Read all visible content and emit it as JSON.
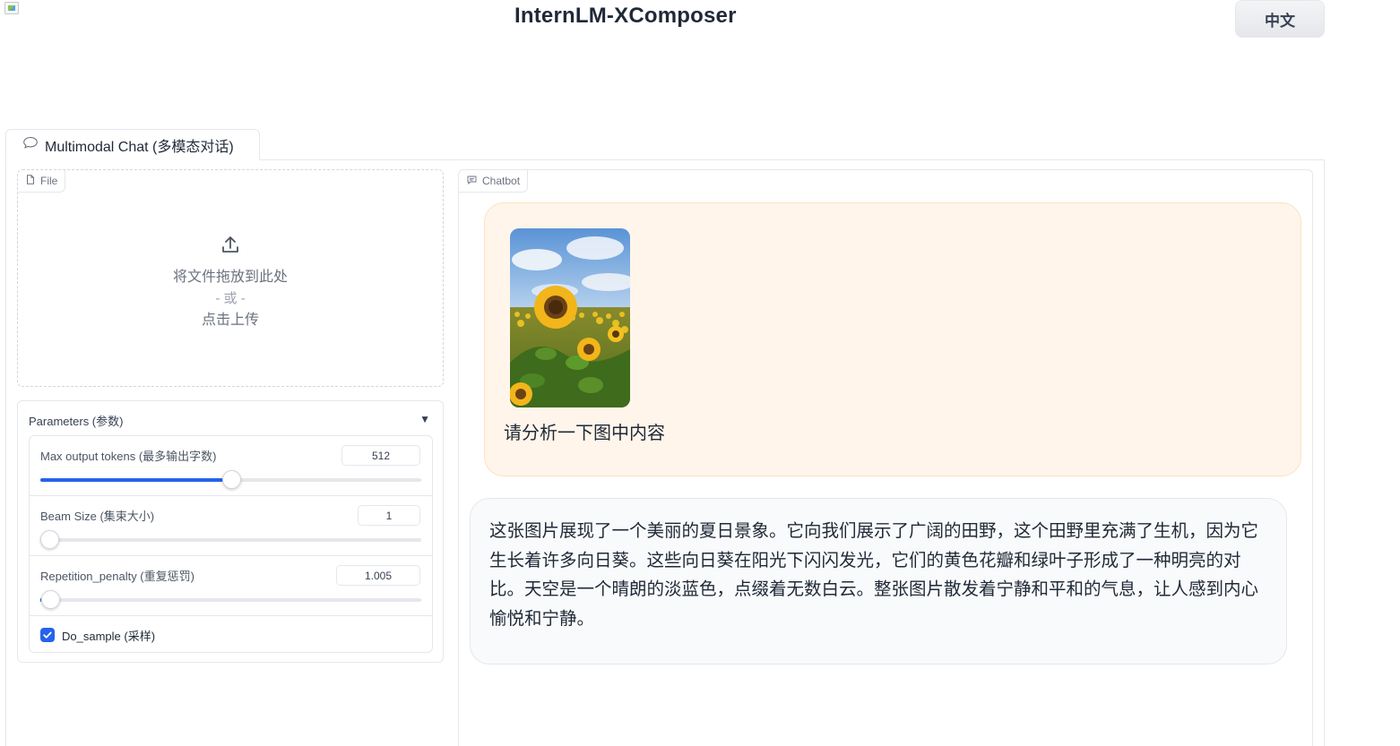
{
  "header": {
    "title": "InternLM-XComposer",
    "language_button": "中文"
  },
  "tabs": [
    {
      "label": "Multimodal Chat (多模态对话)",
      "icon": "speech-bubble-icon"
    }
  ],
  "file_upload": {
    "label": "File",
    "drop_text": "将文件拖放到此处",
    "or_text": "- 或 -",
    "click_text": "点击上传"
  },
  "parameters": {
    "title": "Parameters (参数)",
    "sliders": [
      {
        "label": "Max output tokens (最多输出字数)",
        "value": "512",
        "fraction": 0.5
      },
      {
        "label": "Beam Size (集束大小)",
        "value": "1",
        "fraction": 0.0
      },
      {
        "label": "Repetition_penalty (重复惩罚)",
        "value": "1.005",
        "fraction": 0.003
      }
    ],
    "do_sample": {
      "label": "Do_sample (采样)",
      "checked": true
    }
  },
  "chatbot": {
    "label": "Chatbot",
    "messages": [
      {
        "role": "user",
        "image": "sunflower-field-photo",
        "text": "请分析一下图中内容"
      },
      {
        "role": "bot",
        "text": "这张图片展现了一个美丽的夏日景象。它向我们展示了广阔的田野，这个田野里充满了生机，因为它生长着许多向日葵。这些向日葵在阳光下闪闪发光，它们的黄色花瓣和绿叶子形成了一种明亮的对比。天空是一个晴朗的淡蓝色，点缀着无数白云。整张图片散发着宁静和平和的气息，让人感到内心愉悦和宁静。"
      }
    ]
  },
  "colors": {
    "accent": "#2563eb",
    "user_bubble": "#fff5ea",
    "user_bubble_border": "#fde1c3",
    "bot_bubble": "#f9fafb"
  }
}
